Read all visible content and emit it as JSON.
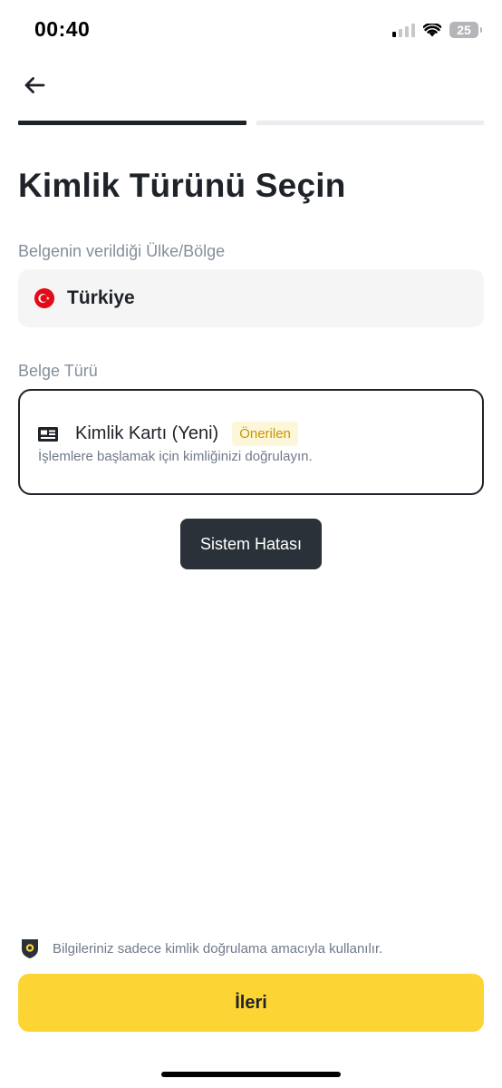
{
  "status_bar": {
    "time": "00:40",
    "battery": "25",
    "signal_bars_active": 1,
    "signal_bars_total": 4
  },
  "header": {
    "back_icon": "arrow-left-icon"
  },
  "progress": {
    "total_steps": 2,
    "current_step": 1,
    "active_color": "#1e2329",
    "inactive_color": "#eaecef"
  },
  "page": {
    "title": "Kimlik Türünü Seçin"
  },
  "country_field": {
    "label": "Belgenin verildiği Ülke/Bölge",
    "value": "Türkiye",
    "flag_icon": "turkey-flag-icon"
  },
  "document_field": {
    "label": "Belge Türü",
    "option": {
      "icon": "id-card-icon",
      "name": "Kimlik Kartı (Yeni)",
      "badge": "Önerilen",
      "description": "İşlemlere başlamak için kimliğinizi doğrulayın."
    }
  },
  "toast": {
    "message": "Sistem Hatası"
  },
  "footer": {
    "privacy_icon": "shield-icon",
    "privacy_text": "Bilgileriniz sadece kimlik doğrulama amacıyla kullanılır.",
    "next_label": "İleri"
  },
  "colors": {
    "accent": "#fcd535",
    "badge_bg": "#fdf7d9",
    "badge_text": "#c99400",
    "toast_bg": "#2b3139"
  }
}
